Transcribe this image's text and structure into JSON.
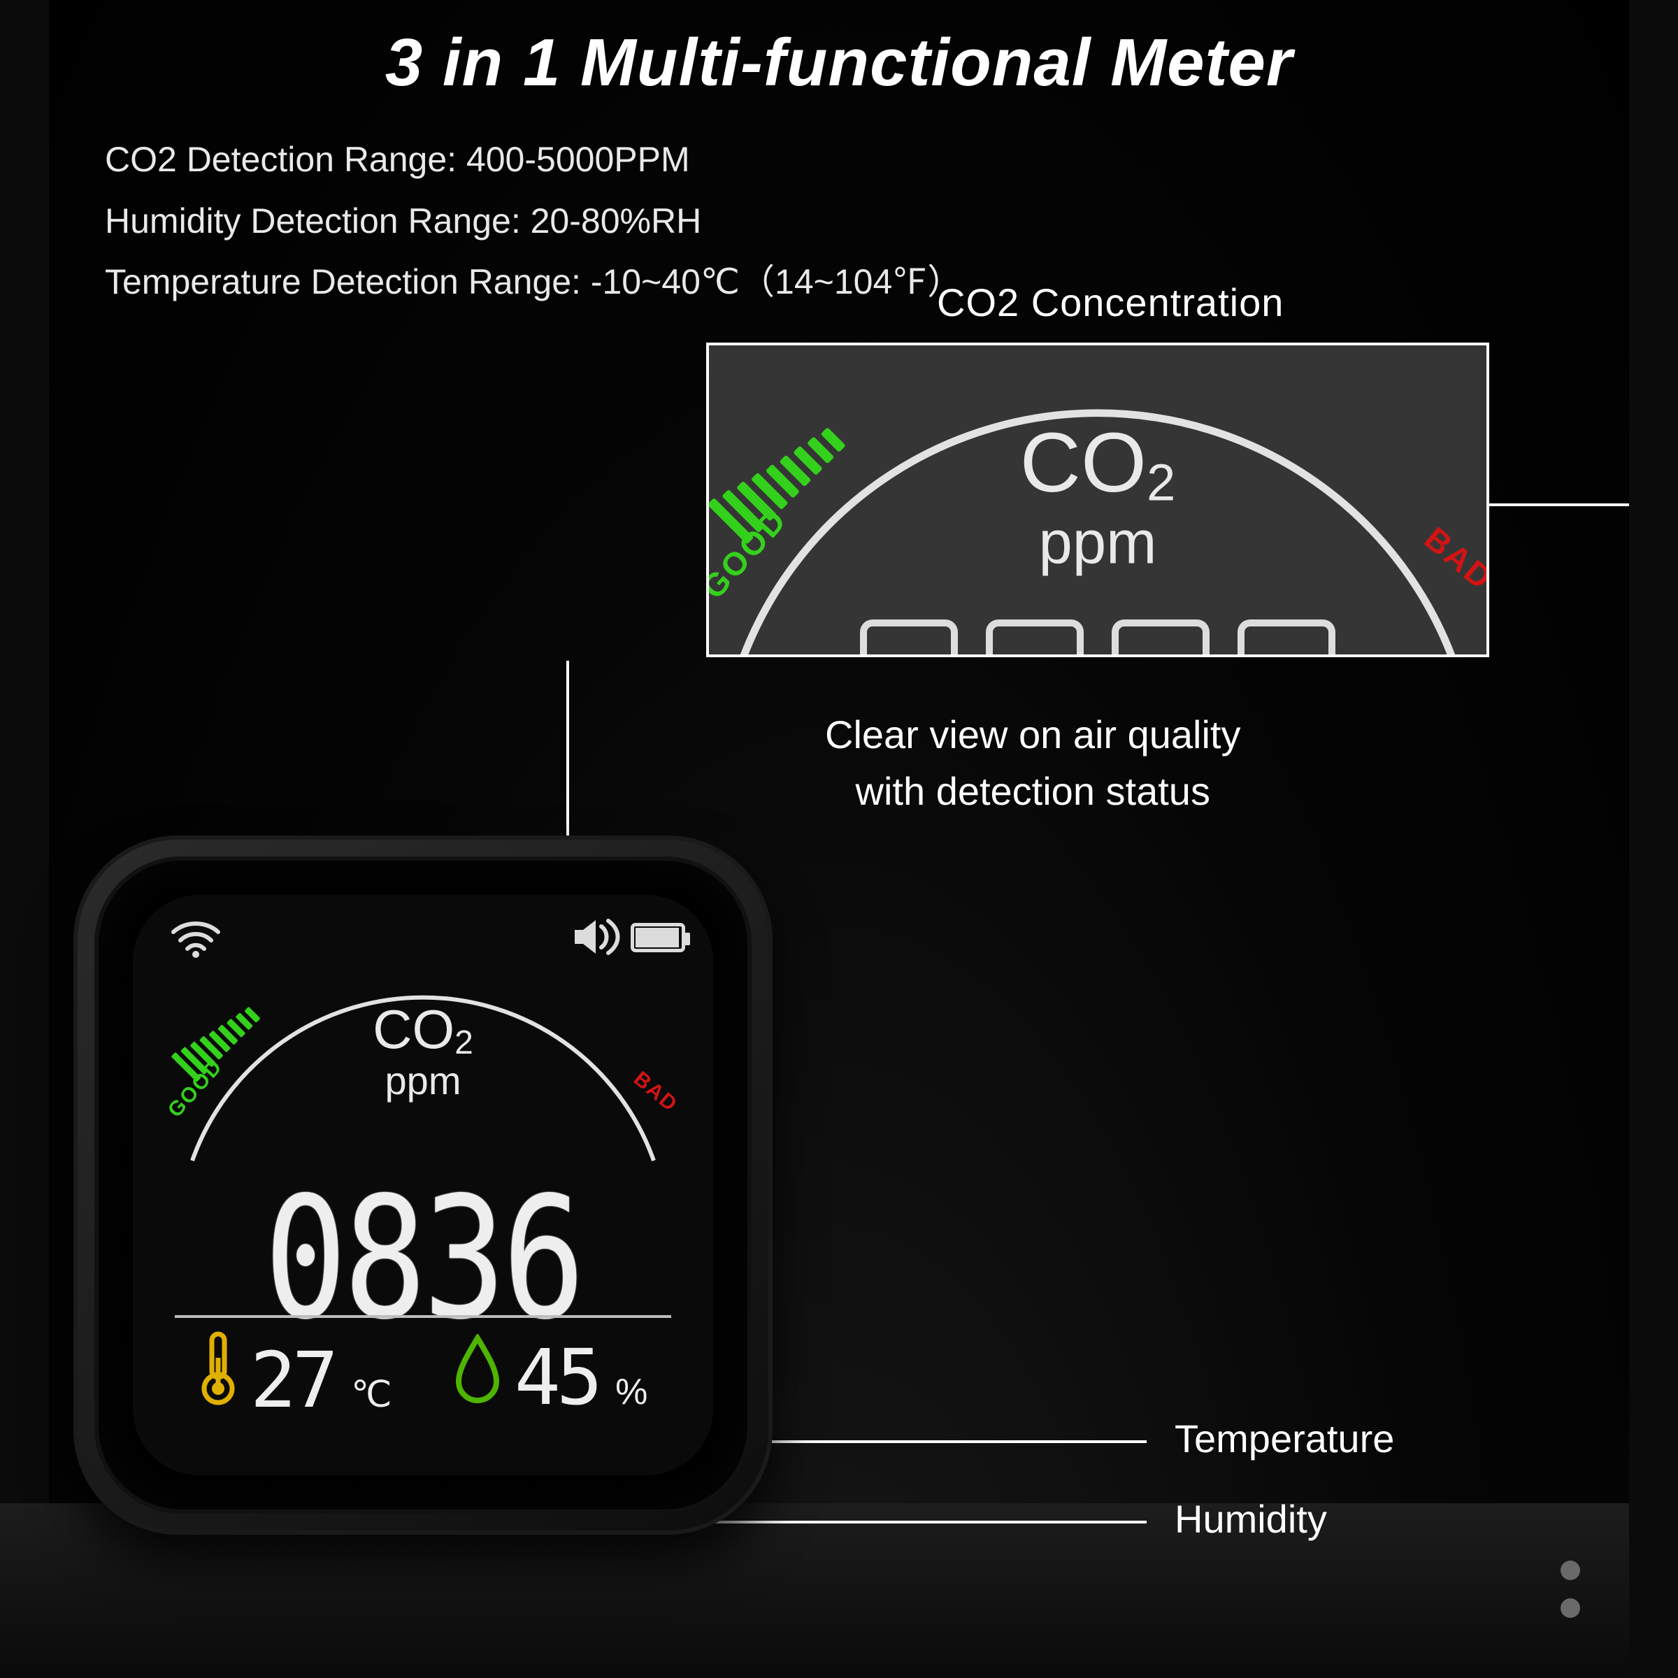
{
  "title": "3 in 1 Multi-functional Meter",
  "specs": {
    "co2": "CO2 Detection Range: 400-5000PPM",
    "hum": "Humidity Detection Range: 20-80%RH",
    "temp": "Temperature Detection Range: -10~40℃（14~104℉）"
  },
  "callouts": {
    "co2_label": "CO2 Concentration",
    "co2_sub": "Clear view on air quality\nwith detection status",
    "temp": "Temperature",
    "hum": "Humidity"
  },
  "device": {
    "status": {
      "wifi": true,
      "speaker": true,
      "battery_pct": 90
    },
    "gauge": {
      "label_formula": "CO",
      "label_sub": "2",
      "unit": "ppm",
      "good_text": "GOOD",
      "bad_text": "BAD",
      "good_color": "#34d11c",
      "bad_color": "#d11414"
    },
    "co2_reading": "0836",
    "temperature": {
      "value": "27",
      "unit": "℃",
      "icon_color": "#e0b000"
    },
    "humidity": {
      "value": "45",
      "unit": "%",
      "icon_color": "#4fb400"
    }
  }
}
